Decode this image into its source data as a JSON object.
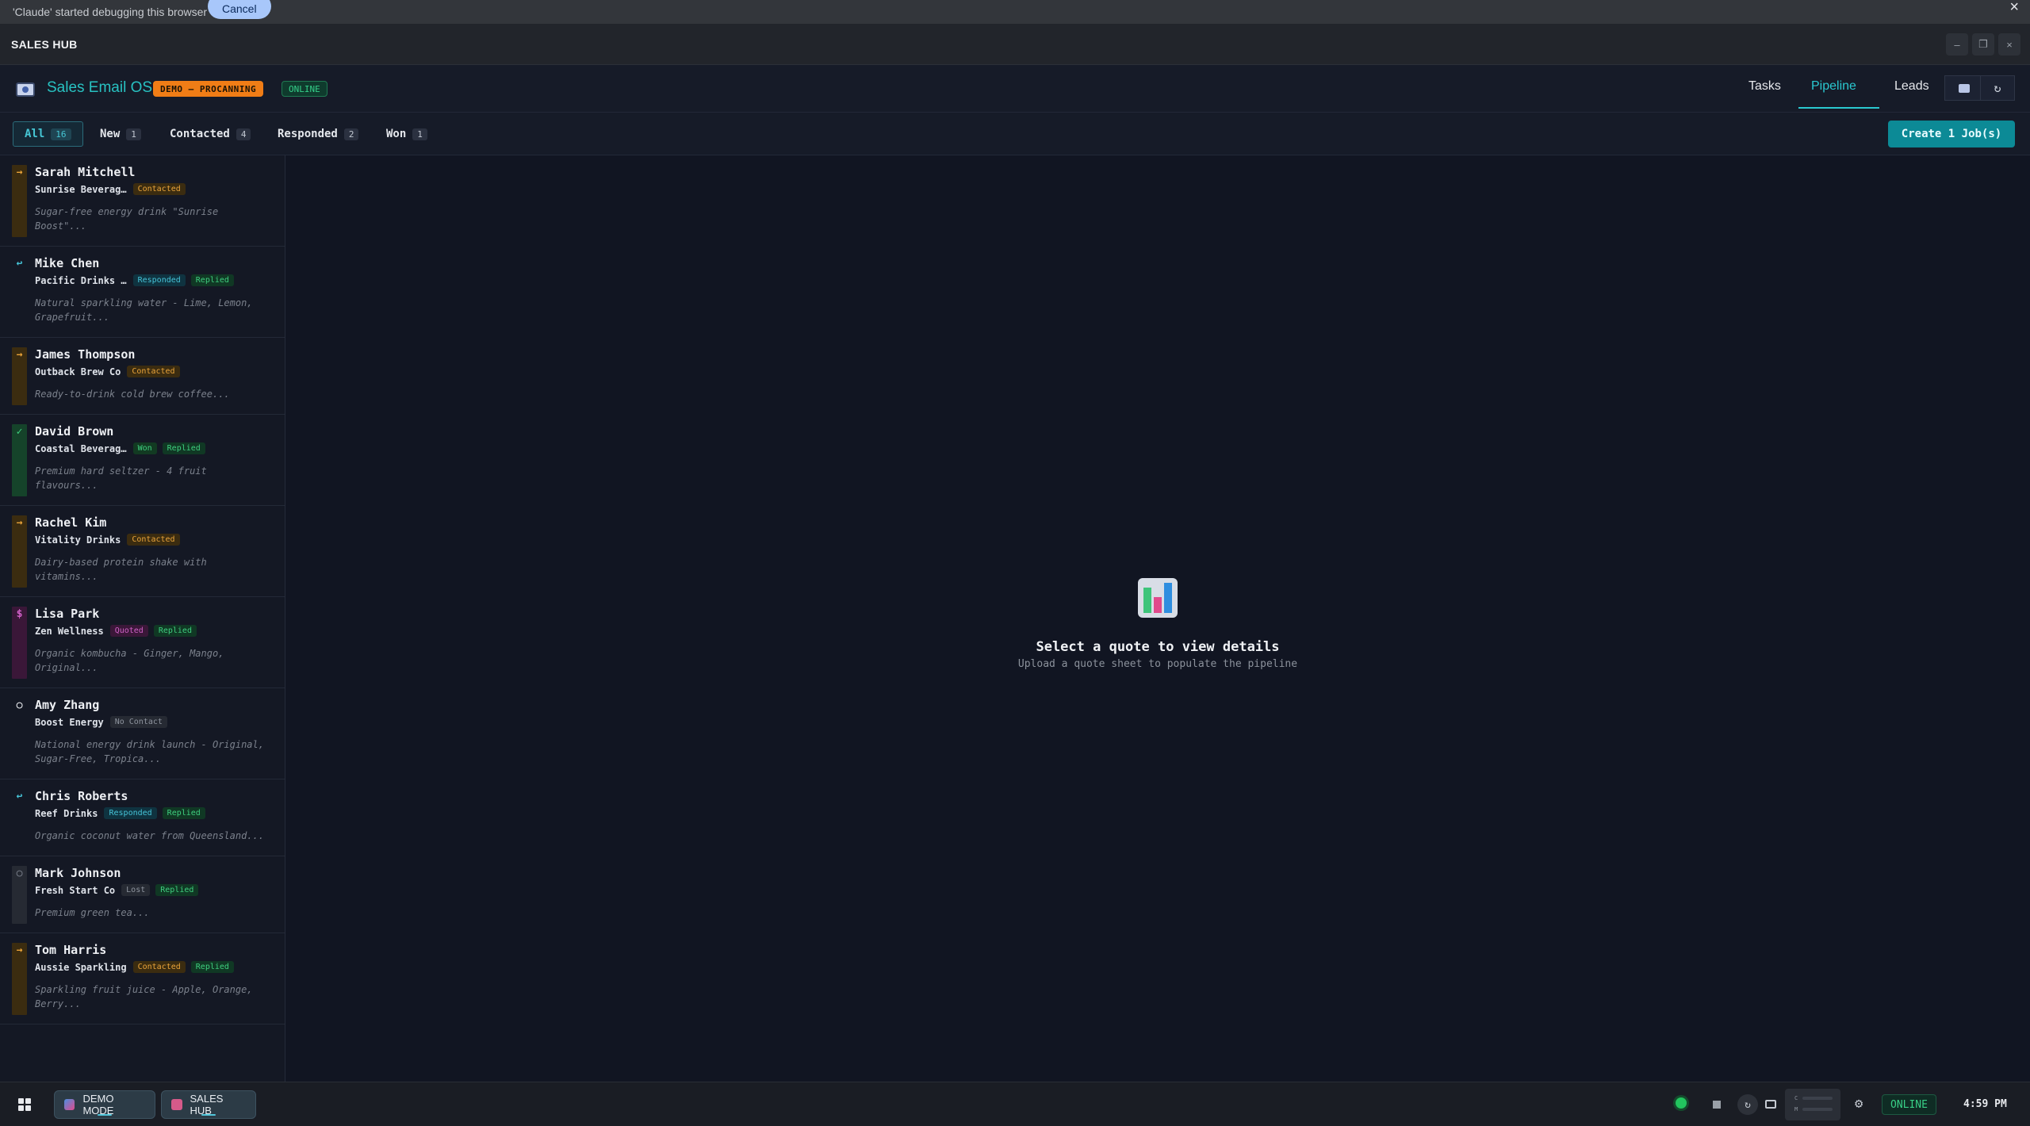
{
  "debug_bar": {
    "message": "'Claude' started debugging this browser",
    "cancel_label": "Cancel",
    "close_icon": "×"
  },
  "window": {
    "title": "SALES HUB",
    "controls": [
      "–",
      "❐",
      "×"
    ]
  },
  "header": {
    "app_title": "Sales Email OS",
    "demo_badge": "DEMO — PROCANNING",
    "status_badge": "ONLINE",
    "nav": [
      "Tasks",
      "Pipeline",
      "Leads"
    ],
    "active_nav": "Pipeline"
  },
  "filters": {
    "tabs": [
      {
        "label": "All",
        "count": "16"
      },
      {
        "label": "New",
        "count": "1"
      },
      {
        "label": "Contacted",
        "count": "4"
      },
      {
        "label": "Responded",
        "count": "2"
      },
      {
        "label": "Won",
        "count": "1"
      }
    ],
    "active": "All",
    "create_button": "Create 1 Job(s)"
  },
  "leads": [
    {
      "name": "Sarah Mitchell",
      "company": "Sunrise Beverag…",
      "tags": [
        "Contacted"
      ],
      "desc": "Sugar-free energy drink \"Sunrise Boost\"...",
      "icon": "→",
      "status": "contacted"
    },
    {
      "name": "Mike Chen",
      "company": "Pacific Drinks …",
      "tags": [
        "Responded",
        "Replied"
      ],
      "desc": "Natural sparkling water - Lime, Lemon, Grapefruit...",
      "icon": "↩",
      "status": "responded"
    },
    {
      "name": "James Thompson",
      "company": "Outback Brew Co",
      "tags": [
        "Contacted"
      ],
      "desc": "Ready-to-drink cold brew coffee...",
      "icon": "→",
      "status": "contacted"
    },
    {
      "name": "David Brown",
      "company": "Coastal Beverag…",
      "tags": [
        "Won",
        "Replied"
      ],
      "desc": "Premium hard seltzer - 4 fruit flavours...",
      "icon": "✓",
      "status": "won"
    },
    {
      "name": "Rachel Kim",
      "company": "Vitality Drinks",
      "tags": [
        "Contacted"
      ],
      "desc": "Dairy-based protein shake with vitamins...",
      "icon": "→",
      "status": "contacted"
    },
    {
      "name": "Lisa Park",
      "company": "Zen Wellness",
      "tags": [
        "Quoted",
        "Replied"
      ],
      "desc": "Organic kombucha - Ginger, Mango, Original...",
      "icon": "$",
      "status": "quoted"
    },
    {
      "name": "Amy Zhang",
      "company": "Boost Energy",
      "tags": [
        "No Contact"
      ],
      "desc": "National energy drink launch - Original, Sugar-Free, Tropica...",
      "icon": "○",
      "status": "new"
    },
    {
      "name": "Chris Roberts",
      "company": "Reef Drinks",
      "tags": [
        "Responded",
        "Replied"
      ],
      "desc": "Organic coconut water from Queensland...",
      "icon": "↩",
      "status": "responded"
    },
    {
      "name": "Mark Johnson",
      "company": "Fresh Start Co",
      "tags": [
        "Lost",
        "Replied"
      ],
      "desc": "Premium green tea...",
      "icon": "○",
      "status": "lost"
    },
    {
      "name": "Tom Harris",
      "company": "Aussie Sparkling",
      "tags": [
        "Contacted",
        "Replied"
      ],
      "desc": "Sparkling fruit juice - Apple, Orange, Berry...",
      "icon": "→",
      "status": "contacted"
    }
  ],
  "empty_state": {
    "title": "Select a quote to view details",
    "subtitle": "Upload a quote sheet to populate the pipeline"
  },
  "taskbar": {
    "apps": [
      {
        "label": "DEMO MODE"
      },
      {
        "label": "SALES HUB"
      }
    ],
    "status": "ONLINE",
    "clock": "4:59 PM",
    "tray_labels": [
      "C",
      "M"
    ]
  },
  "colors": {
    "accent": "#2ac8d0",
    "contacted": "#eaa43a",
    "responded": "#46c4d8",
    "won": "#3fcf7f",
    "quoted": "#d061c8",
    "demo": "#f07d16"
  }
}
